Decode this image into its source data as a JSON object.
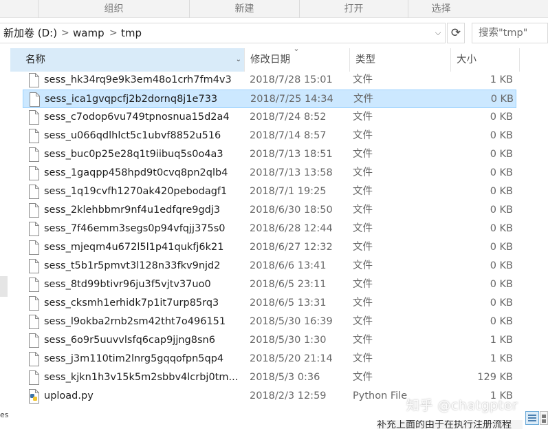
{
  "ribbon": {
    "groups": [
      "组织",
      "新建",
      "打开",
      "选择"
    ]
  },
  "address": {
    "crumbs": [
      "新加卷 (D:)",
      "wamp",
      "tmp"
    ],
    "separator": ">",
    "search_placeholder": "搜索\"tmp\""
  },
  "columns": {
    "name": "名称",
    "date": "修改日期",
    "type": "类型",
    "size": "大小"
  },
  "files": [
    {
      "name": "sess_hk34rq9e9k3em48o1crh7fm4v3",
      "date": "2018/7/28 15:01",
      "type": "文件",
      "size": "1 KB",
      "icon": "file-icon"
    },
    {
      "name": "sess_ica1gvqpcfj2b2dornq8j1e733",
      "date": "2018/7/25 14:34",
      "type": "文件",
      "size": "0 KB",
      "icon": "file-icon",
      "selected": true
    },
    {
      "name": "sess_c7odop6vu749tpnosnua15d2a4",
      "date": "2018/7/24 8:52",
      "type": "文件",
      "size": "0 KB",
      "icon": "file-icon"
    },
    {
      "name": "sess_u066qdlhlct5c1ubvf8852u516",
      "date": "2018/7/14 8:57",
      "type": "文件",
      "size": "0 KB",
      "icon": "file-icon"
    },
    {
      "name": "sess_buc0p25e28q1t9iibuq5s0o4a3",
      "date": "2018/7/13 18:51",
      "type": "文件",
      "size": "0 KB",
      "icon": "file-icon"
    },
    {
      "name": "sess_1gaqpp458hpd9t0cvq8pn2qlb4",
      "date": "2018/7/13 13:58",
      "type": "文件",
      "size": "0 KB",
      "icon": "file-icon"
    },
    {
      "name": "sess_1q19cvfh1270ak420pebodagf1",
      "date": "2018/7/1 19:25",
      "type": "文件",
      "size": "0 KB",
      "icon": "file-icon"
    },
    {
      "name": "sess_2klehbbmr9nf4u1edfqre9gdj3",
      "date": "2018/6/30 18:50",
      "type": "文件",
      "size": "0 KB",
      "icon": "file-icon"
    },
    {
      "name": "sess_7f46emm3segs0p94vfqjj375s0",
      "date": "2018/6/28 12:44",
      "type": "文件",
      "size": "0 KB",
      "icon": "file-icon"
    },
    {
      "name": "sess_mjeqm4u672l5l1p41qukfj6k21",
      "date": "2018/6/27 12:32",
      "type": "文件",
      "size": "0 KB",
      "icon": "file-icon"
    },
    {
      "name": "sess_t5b1r5pmvt3l128n33fkv9njd2",
      "date": "2018/6/6 13:41",
      "type": "文件",
      "size": "0 KB",
      "icon": "file-icon"
    },
    {
      "name": "sess_8td99btivr96ju3f5vjtv37uo0",
      "date": "2018/6/5 23:11",
      "type": "文件",
      "size": "0 KB",
      "icon": "file-icon"
    },
    {
      "name": "sess_cksmh1erhidk7p1it7urp85rq3",
      "date": "2018/6/5 13:31",
      "type": "文件",
      "size": "0 KB",
      "icon": "file-icon"
    },
    {
      "name": "sess_l9okba2rnb2sm42tht7o496151",
      "date": "2018/5/30 16:39",
      "type": "文件",
      "size": "0 KB",
      "icon": "file-icon"
    },
    {
      "name": "sess_6o9r5uuvvlsfq6cap9jjng8sn6",
      "date": "2018/5/30 1:30",
      "type": "文件",
      "size": "1 KB",
      "icon": "file-icon"
    },
    {
      "name": "sess_j3m110tim2lnrg5gqqofpn5qp4",
      "date": "2018/5/20 21:14",
      "type": "文件",
      "size": "1 KB",
      "icon": "file-icon"
    },
    {
      "name": "sess_kjkn1h3v15k5m2sbbv4lcrbj0tm...",
      "date": "2018/5/3 0:36",
      "type": "文件",
      "size": "129 KB",
      "icon": "file-icon"
    },
    {
      "name": "upload.py",
      "date": "2018/2/3 12:59",
      "type": "Python File",
      "size": "1 KB",
      "icon": "python-file-icon"
    }
  ],
  "overlay": {
    "watermark": "知乎 @chatgpter",
    "below_text": "补充上面的由于在执行注册流程"
  },
  "nav_fragment": "es"
}
